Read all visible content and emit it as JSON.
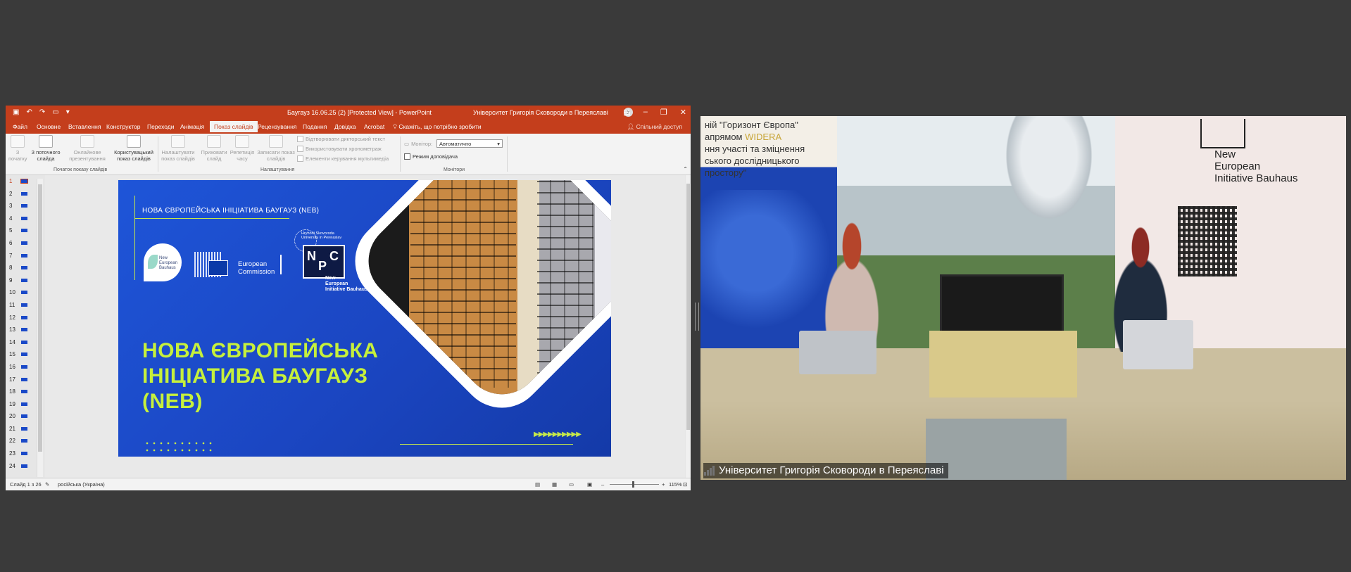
{
  "titlebar": {
    "document": "Баугауз 16.06.25 (2) [Protected View] - PowerPoint",
    "account": "Університет Григорія Сковороди в Переяславі",
    "user_initial": "У"
  },
  "ribbon_tabs": [
    "Файл",
    "Основне",
    "Вставлення",
    "Конструктор",
    "Переходи",
    "Анімація",
    "Показ слайдів",
    "Рецензування",
    "Подання",
    "Довідка",
    "Acrobat"
  ],
  "active_tab": "Показ слайдів",
  "tell_me": "Скажіть, що потрібно зробити",
  "share": "Спільний доступ",
  "ribbon": {
    "start": {
      "from_start": "З початку",
      "from_current": "З поточного слайда",
      "online": "Онлайнове презентування",
      "custom": "Користувацький показ слайдів",
      "group": "Початок показу слайдів"
    },
    "setup": {
      "setup_show": "Налаштувати показ слайдів",
      "hide_slide": "Приховати слайд",
      "rehearse": "Репетиція часу",
      "record": "Записати показ слайдів",
      "play_narrations": "Відтворювати дикторський текст",
      "use_timings": "Використовувати хронометраж",
      "show_media": "Елементи керування мультимедіа",
      "group": "Налаштування"
    },
    "monitors": {
      "monitor_label": "Монітор:",
      "monitor_value": "Автоматично",
      "presenter_view": "Режим доповідача",
      "group": "Монітори"
    }
  },
  "thumbnails": [
    "1",
    "2",
    "3",
    "4",
    "5",
    "6",
    "7",
    "8",
    "9",
    "10",
    "11",
    "12",
    "13",
    "14",
    "15",
    "16",
    "17",
    "18",
    "19",
    "20",
    "21",
    "22",
    "23",
    "24"
  ],
  "status": {
    "slide": "Слайд 1 з 26",
    "language": "російська (Україна)",
    "zoom": "115%"
  },
  "slide": {
    "header": "НОВА ЄВРОПЕЙСЬКА ІНІЦІАТИВА БАУГАУЗ (NEB)",
    "logo_neb_line1": "New",
    "logo_neb_line2": "European",
    "logo_neb_line3": "Bauhaus",
    "logo_ec_line1": "European",
    "logo_ec_line2": "Commission",
    "uni_line1": "Hryhorii Skovoroda",
    "uni_line2": "University in Pereiaslav",
    "npc_n": "N",
    "npc_p": "P",
    "npc_c": "C",
    "npc_cap1": "New",
    "npc_cap2": "European",
    "npc_cap3": "Initiative Bauhaus",
    "title_line1": "НОВА ЄВРОПЕЙСЬКА",
    "title_line2": "ІНІЦІАТИВА БАУГАУЗ",
    "title_line3": "(NEB)",
    "arrows": "▶▶▶▶▶▶▶▶▶▶"
  },
  "video": {
    "banner_line1": "ній \"Горизонт Європа\"",
    "banner_line2_pre": "апрямом ",
    "banner_line2_hl": "WIDERA",
    "banner_line3": "ння участі та зміцнення",
    "banner_line4": "ського дослідницького",
    "banner_line5": "простору\"",
    "neb_line1": "New",
    "neb_line2": "European",
    "neb_line3": "Initiative Bauhaus",
    "participant": "Університет Григорія Сковороди в Переяславі"
  }
}
